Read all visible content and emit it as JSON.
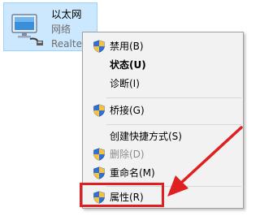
{
  "adapter": {
    "name": "以太网",
    "type": "网络",
    "device": "Realte"
  },
  "menu": {
    "items": [
      {
        "label": "禁用(B)",
        "icon": "uac-shield-icon"
      },
      {
        "label": "状态(U)",
        "bold": true
      },
      {
        "label": "诊断(I)"
      },
      {
        "label": "桥接(G)",
        "icon": "uac-shield-icon"
      },
      {
        "label": "创建快捷方式(S)"
      },
      {
        "label": "删除(D)",
        "icon": "uac-shield-icon",
        "disabled": true
      },
      {
        "label": "重命名(M)",
        "icon": "uac-shield-icon"
      },
      {
        "label": "属性(R)",
        "icon": "uac-shield-icon"
      }
    ]
  },
  "annotation": {
    "color": "#e02020",
    "target": "属性(R)"
  },
  "colors": {
    "selection_bg": "#cce8ff",
    "menu_bg": "#f2f2f2"
  }
}
